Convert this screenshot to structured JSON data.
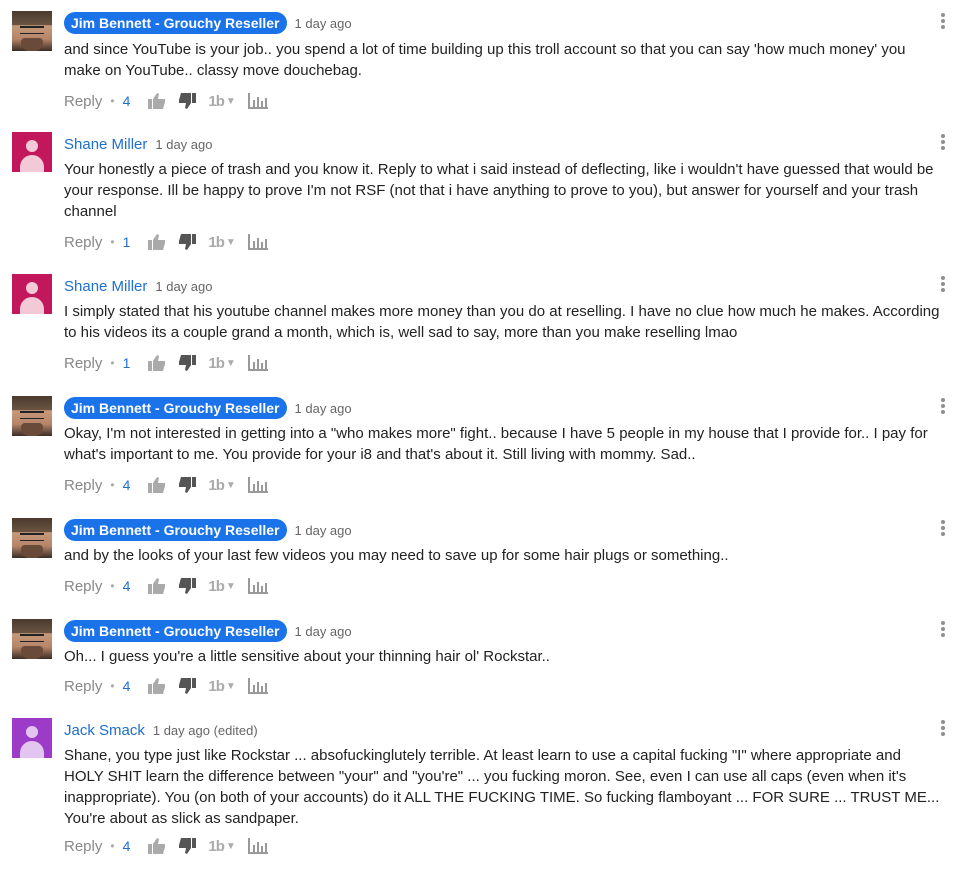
{
  "comments": [
    {
      "author": "Jim Bennett - Grouchy Reseller",
      "time": "1 day ago",
      "text": "and since YouTube is your job.. you spend a lot of time building up this troll account so that you can say 'how much money' you make on YouTube.. classy move douchebag.",
      "reply_label": "Reply",
      "count": "4"
    },
    {
      "author": "Shane Miller",
      "time": "1 day ago",
      "text": "Your honestly a piece of trash and you know it. Reply to what i said instead of deflecting, like i wouldn't have guessed that would be your response. Ill be happy to prove I'm not RSF (not that i have anything to prove to you), but answer for yourself and your trash channel",
      "reply_label": "Reply",
      "count": "1"
    },
    {
      "author": "Shane Miller",
      "time": "1 day ago",
      "text": "I simply stated that his youtube channel makes more money than you do at reselling. I have no clue how much he makes. According to his videos its a couple grand a month, which is, well sad to say, more than you make reselling lmao",
      "reply_label": "Reply",
      "count": "1"
    },
    {
      "author": "Jim Bennett - Grouchy Reseller",
      "time": "1 day ago",
      "text": "Okay, I'm not interested in getting into a \"who makes more\" fight.. because I have 5 people in my house that I provide for.. I pay for what's important to me. You provide for your i8 and that's about it. Still living with mommy. Sad..",
      "reply_label": "Reply",
      "count": "4"
    },
    {
      "author": "Jim Bennett - Grouchy Reseller",
      "time": "1 day ago",
      "text": "and by the looks of your last few videos you may need to save up for some hair plugs or something..",
      "reply_label": "Reply",
      "count": "4"
    },
    {
      "author": "Jim Bennett - Grouchy Reseller",
      "time": "1 day ago",
      "text": "Oh... I guess you're a little sensitive about your thinning hair ol' Rockstar..",
      "reply_label": "Reply",
      "count": "4"
    },
    {
      "author": "Jack Smack",
      "time": "1 day ago (edited)",
      "text": "Shane, you type just like Rockstar ... absofuckinglutely terrible. At least learn to use a capital fucking \"I\" where appropriate and HOLY SHIT learn the difference between \"your\" and \"you're\" ... you fucking moron. See, even I can use all caps (even when it's inappropriate). You (on both of your accounts) do it ALL THE FUCKING TIME. So fucking flamboyant ... FOR SURE ... TRUST ME... You're about as slick as sandpaper.",
      "reply_label": "Reply",
      "count": "4"
    }
  ],
  "icons": {
    "like": "thumbs-up-icon",
    "dislike": "thumbs-down-icon",
    "translate": "translate-icon",
    "stats": "bar-chart-icon",
    "menu": "kebab-menu-icon"
  },
  "colors": {
    "author_link": "#1e6fcf",
    "badge_bg": "#1a73e8",
    "avatar_pink": "#c2185b",
    "avatar_purple": "#9c3bc7"
  }
}
